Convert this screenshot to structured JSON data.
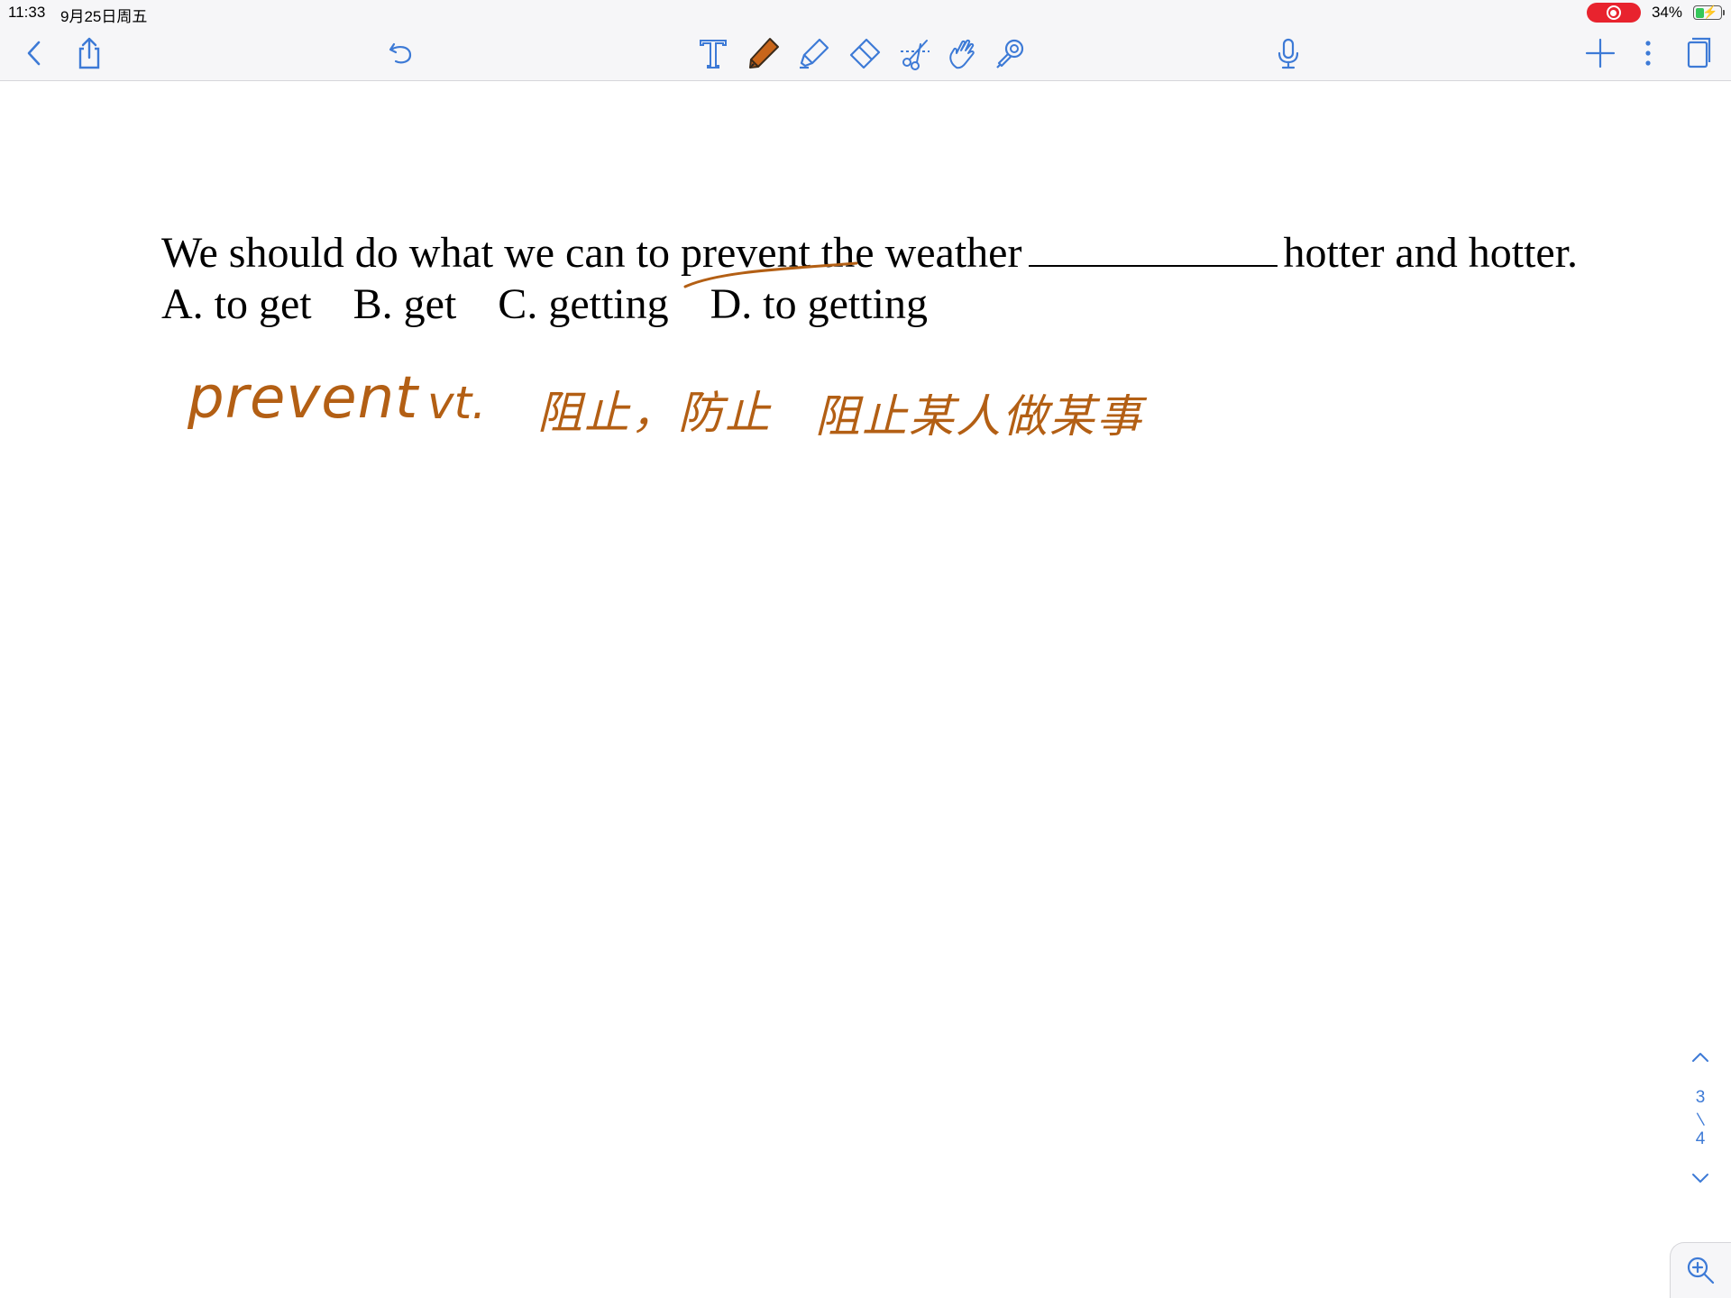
{
  "status_bar": {
    "time": "11:33",
    "date": "9月25日周五",
    "battery_percent": "34%",
    "battery_level": 0.34,
    "recording": true
  },
  "toolbar": {
    "left": [
      "back-icon",
      "share-icon",
      "undo-icon"
    ],
    "center": [
      "text-tool-icon",
      "pen-tool-icon",
      "highlighter-tool-icon",
      "eraser-tool-icon",
      "lasso-scissors-icon",
      "hand-tool-icon",
      "laser-pointer-icon"
    ],
    "right": [
      "microphone-icon",
      "add-icon",
      "more-icon",
      "pages-icon"
    ],
    "active_tool": "pen-tool-icon",
    "accent_color": "#3d7ad6",
    "pen_color": "#c8651a"
  },
  "document": {
    "question_part1": "We should do what we can to prevent the weather",
    "question_part2": "hotter and hotter.",
    "options": [
      "A. to get",
      "B. get",
      "C. getting",
      "D. to getting"
    ]
  },
  "annotations": {
    "ink_color": "#b35f14",
    "word": "prevent",
    "part_of_speech": "vt.",
    "meaning": "阻止，防止",
    "phrase": "阻止某人做某事"
  },
  "page_nav": {
    "current": "3",
    "total": "4"
  }
}
